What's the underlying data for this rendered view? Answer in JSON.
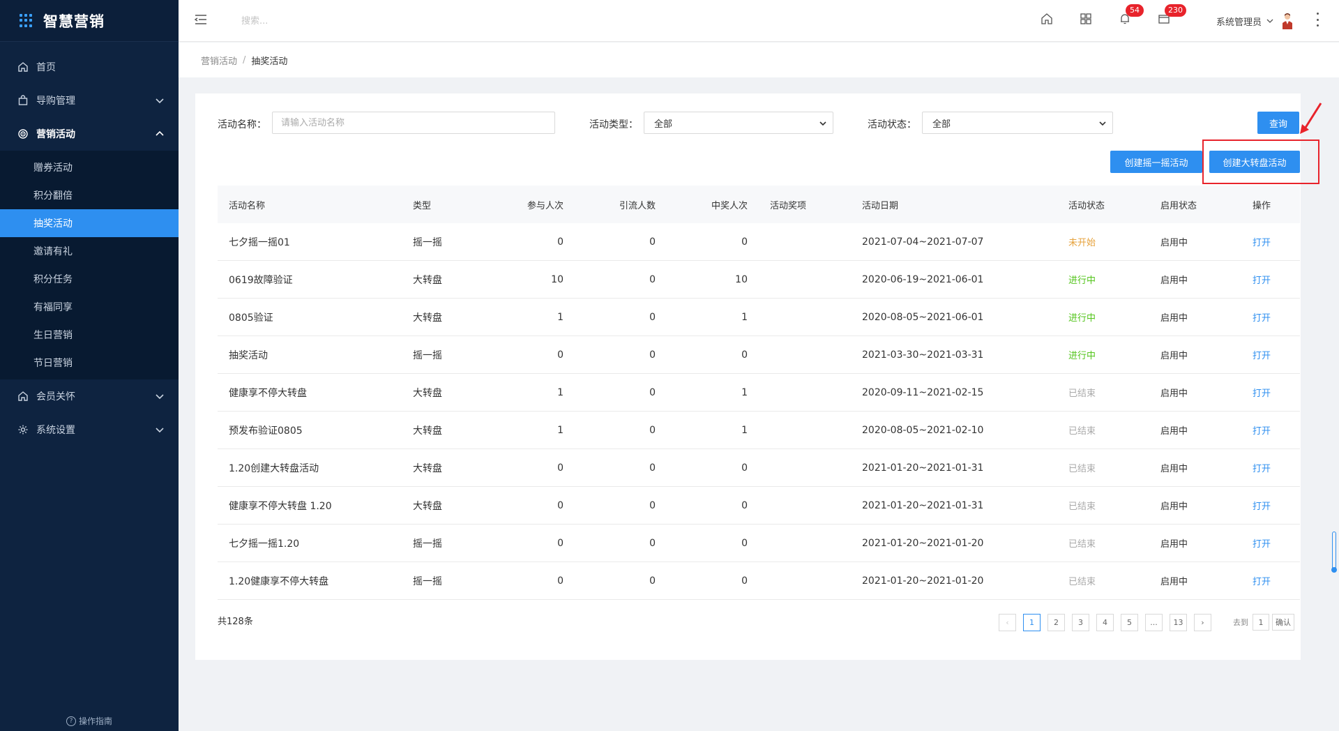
{
  "app": {
    "title": "智慧营销"
  },
  "sidebar": {
    "items": [
      {
        "label": "首页",
        "icon": "home-icon"
      },
      {
        "label": "导购管理",
        "icon": "bag-icon"
      },
      {
        "label": "营销活动",
        "icon": "target-icon"
      },
      {
        "label": "会员关怀",
        "icon": "home-icon"
      },
      {
        "label": "系统设置",
        "icon": "gear-icon"
      }
    ],
    "submenu": [
      {
        "label": "赠券活动"
      },
      {
        "label": "积分翻倍"
      },
      {
        "label": "抽奖活动"
      },
      {
        "label": "邀请有礼"
      },
      {
        "label": "积分任务"
      },
      {
        "label": "有福同享"
      },
      {
        "label": "生日营销"
      },
      {
        "label": "节日营销"
      }
    ],
    "footer": "操作指南"
  },
  "header": {
    "search_placeholder": "搜索...",
    "notification_count": "54",
    "message_count": "230",
    "user_name": "系统管理员"
  },
  "breadcrumb": {
    "parent": "营销活动",
    "separator": "/",
    "current": "抽奖活动"
  },
  "filters": {
    "name_label": "活动名称：",
    "name_placeholder": "请输入活动名称",
    "type_label": "活动类型：",
    "type_value": "全部",
    "status_label": "活动状态：",
    "status_value": "全部",
    "query_button": "查询",
    "create_shake_button": "创建摇一摇活动",
    "create_wheel_button": "创建大转盘活动"
  },
  "table": {
    "headers": [
      "活动名称",
      "类型",
      "参与人次",
      "引流人数",
      "中奖人次",
      "活动奖项",
      "活动日期",
      "活动状态",
      "启用状态",
      "操作"
    ],
    "rows": [
      {
        "name": "七夕摇一摇01",
        "type": "摇一摇",
        "participants": "0",
        "leads": "0",
        "winners": "0",
        "prize": "",
        "date": "2021-07-04~2021-07-07",
        "status": "未开始",
        "status_kind": "pending",
        "enabled": "启用中",
        "action": "打开"
      },
      {
        "name": "0619故障验证",
        "type": "大转盘",
        "participants": "10",
        "leads": "0",
        "winners": "10",
        "prize": "",
        "date": "2020-06-19~2021-06-01",
        "status": "进行中",
        "status_kind": "running",
        "enabled": "启用中",
        "action": "打开"
      },
      {
        "name": "0805验证",
        "type": "大转盘",
        "participants": "1",
        "leads": "0",
        "winners": "1",
        "prize": "",
        "date": "2020-08-05~2021-06-01",
        "status": "进行中",
        "status_kind": "running",
        "enabled": "启用中",
        "action": "打开"
      },
      {
        "name": "抽奖活动",
        "type": "摇一摇",
        "participants": "0",
        "leads": "0",
        "winners": "0",
        "prize": "",
        "date": "2021-03-30~2021-03-31",
        "status": "进行中",
        "status_kind": "running",
        "enabled": "启用中",
        "action": "打开"
      },
      {
        "name": "健康享不停大转盘",
        "type": "大转盘",
        "participants": "1",
        "leads": "0",
        "winners": "1",
        "prize": "",
        "date": "2020-09-11~2021-02-15",
        "status": "已结束",
        "status_kind": "ended",
        "enabled": "启用中",
        "action": "打开"
      },
      {
        "name": "预发布验证0805",
        "type": "大转盘",
        "participants": "1",
        "leads": "0",
        "winners": "1",
        "prize": "",
        "date": "2020-08-05~2021-02-10",
        "status": "已结束",
        "status_kind": "ended",
        "enabled": "启用中",
        "action": "打开"
      },
      {
        "name": "1.20创建大转盘活动",
        "type": "大转盘",
        "participants": "0",
        "leads": "0",
        "winners": "0",
        "prize": "",
        "date": "2021-01-20~2021-01-31",
        "status": "已结束",
        "status_kind": "ended",
        "enabled": "启用中",
        "action": "打开"
      },
      {
        "name": "健康享不停大转盘 1.20",
        "type": "大转盘",
        "participants": "0",
        "leads": "0",
        "winners": "0",
        "prize": "",
        "date": "2021-01-20~2021-01-31",
        "status": "已结束",
        "status_kind": "ended",
        "enabled": "启用中",
        "action": "打开"
      },
      {
        "name": "七夕摇一摇1.20",
        "type": "摇一摇",
        "participants": "0",
        "leads": "0",
        "winners": "0",
        "prize": "",
        "date": "2021-01-20~2021-01-20",
        "status": "已结束",
        "status_kind": "ended",
        "enabled": "启用中",
        "action": "打开"
      },
      {
        "name": "1.20健康享不停大转盘",
        "type": "摇一摇",
        "participants": "0",
        "leads": "0",
        "winners": "0",
        "prize": "",
        "date": "2021-01-20~2021-01-20",
        "status": "已结束",
        "status_kind": "ended",
        "enabled": "启用中",
        "action": "打开"
      }
    ]
  },
  "pagination": {
    "total": "共128条",
    "prev": "‹",
    "next": "›",
    "pages": [
      "1",
      "2",
      "3",
      "4",
      "5",
      "...",
      "13"
    ],
    "current": "1",
    "goto_label": "去到",
    "goto_value": "1",
    "confirm": "确认"
  },
  "colors": {
    "sidebar_bg": "#0e2340",
    "accent": "#2e8ff0",
    "pending": "#e6a23c",
    "running": "#52c41a",
    "ended": "#aaaaaa",
    "badge": "#e8232b",
    "highlight": "#e8232b"
  }
}
